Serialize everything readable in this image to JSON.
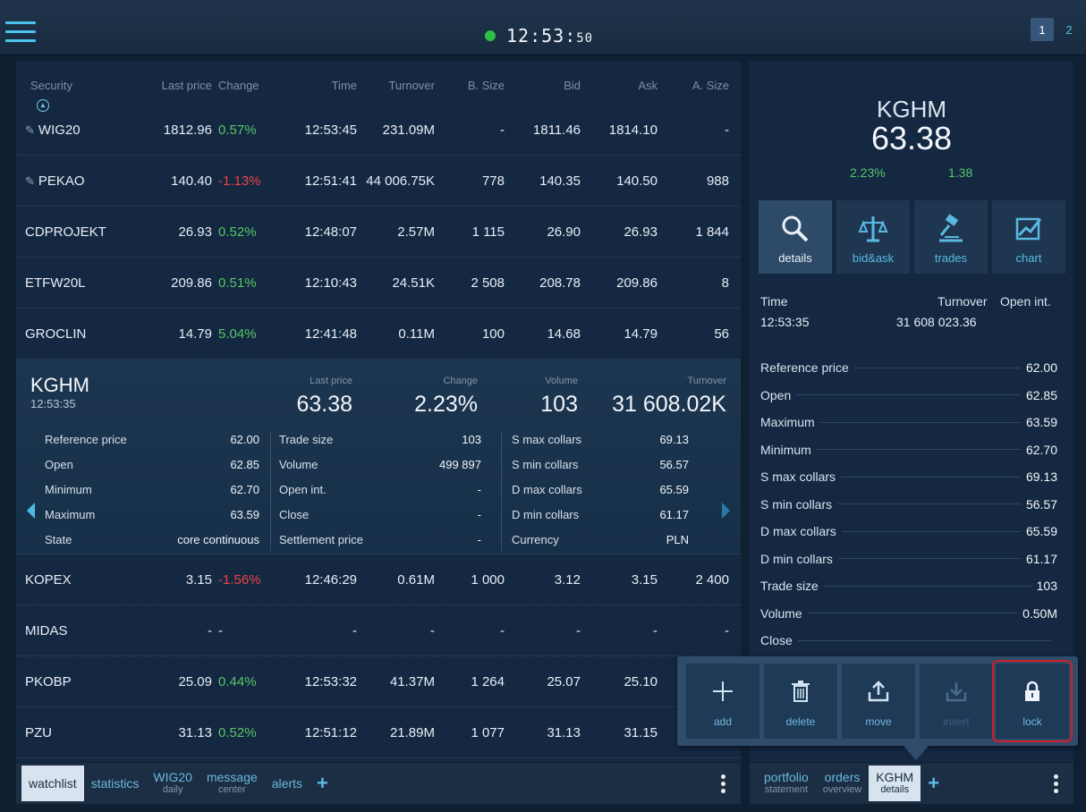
{
  "header": {
    "clock_main": "12:53:",
    "clock_sec": "50",
    "pages": [
      "1",
      "2"
    ],
    "active_page": "1",
    "status_color": "#2fbe45"
  },
  "watchlist": {
    "columns": [
      "Security",
      "Last price",
      "Change",
      "Time",
      "Turnover",
      "B. Size",
      "Bid",
      "Ask",
      "A. Size"
    ],
    "rows_top": [
      {
        "name": "WIG20",
        "pinned": true,
        "last": "1812.96",
        "change": "0.57%",
        "dir": "pos",
        "time": "12:53:45",
        "turnover": "231.09M",
        "bsize": "-",
        "bid": "1811.46",
        "ask": "1814.10",
        "asize": "-"
      },
      {
        "name": "PEKAO",
        "pinned": true,
        "last": "140.40",
        "change": "-1.13%",
        "dir": "neg",
        "time": "12:51:41",
        "turnover": "44 006.75K",
        "bsize": "778",
        "bid": "140.35",
        "ask": "140.50",
        "asize": "988"
      },
      {
        "name": "CDPROJEKT",
        "pinned": false,
        "last": "26.93",
        "change": "0.52%",
        "dir": "pos",
        "time": "12:48:07",
        "turnover": "2.57M",
        "bsize": "1 115",
        "bid": "26.90",
        "ask": "26.93",
        "asize": "1 844"
      },
      {
        "name": "ETFW20L",
        "pinned": false,
        "last": "209.86",
        "change": "0.51%",
        "dir": "pos",
        "time": "12:10:43",
        "turnover": "24.51K",
        "bsize": "2 508",
        "bid": "208.78",
        "ask": "209.86",
        "asize": "8"
      },
      {
        "name": "GROCLIN",
        "pinned": false,
        "last": "14.79",
        "change": "5.04%",
        "dir": "pos",
        "time": "12:41:48",
        "turnover": "0.11M",
        "bsize": "100",
        "bid": "14.68",
        "ask": "14.79",
        "asize": "56"
      }
    ],
    "rows_bottom": [
      {
        "name": "KOPEX",
        "last": "3.15",
        "change": "-1.56%",
        "dir": "neg",
        "time": "12:46:29",
        "turnover": "0.61M",
        "bsize": "1 000",
        "bid": "3.12",
        "ask": "3.15",
        "asize": "2 400"
      },
      {
        "name": "MIDAS",
        "last": "-",
        "change": "-",
        "dir": "none",
        "time": "-",
        "turnover": "-",
        "bsize": "-",
        "bid": "-",
        "ask": "-",
        "asize": "-"
      },
      {
        "name": "PKOBP",
        "last": "25.09",
        "change": "0.44%",
        "dir": "pos",
        "time": "12:53:32",
        "turnover": "41.37M",
        "bsize": "1 264",
        "bid": "25.07",
        "ask": "25.10",
        "asize": ""
      },
      {
        "name": "PZU",
        "last": "31.13",
        "change": "0.52%",
        "dir": "pos",
        "time": "12:51:12",
        "turnover": "21.89M",
        "bsize": "1 077",
        "bid": "31.13",
        "ask": "31.15",
        "asize": ""
      }
    ]
  },
  "expanded": {
    "name": "KGHM",
    "time": "12:53:35",
    "last_label": "Last price",
    "last": "63.38",
    "change_label": "Change",
    "change": "2.23%",
    "volume_label": "Volume",
    "volume": "103",
    "turnover_label": "Turnover",
    "turnover": "31 608.02K",
    "col1": [
      [
        "Reference price",
        "62.00"
      ],
      [
        "Open",
        "62.85"
      ],
      [
        "Minimum",
        "62.70"
      ],
      [
        "Maximum",
        "63.59"
      ],
      [
        "State",
        "core continuous"
      ]
    ],
    "col2": [
      [
        "Trade size",
        "103"
      ],
      [
        "Volume",
        "499 897"
      ],
      [
        "Open int.",
        "-"
      ],
      [
        "Close",
        "-"
      ],
      [
        "Settlement price",
        "-"
      ]
    ],
    "col3": [
      [
        "S max collars",
        "69.13"
      ],
      [
        "S min collars",
        "56.57"
      ],
      [
        "D max collars",
        "65.59"
      ],
      [
        "D min collars",
        "61.17"
      ],
      [
        "Currency",
        "PLN"
      ]
    ]
  },
  "left_tabs": [
    {
      "label": "watchlist",
      "sub": "",
      "active": true
    },
    {
      "label": "statistics",
      "sub": "",
      "active": false
    },
    {
      "label": "WIG20",
      "sub": "daily",
      "active": false
    },
    {
      "label": "message",
      "sub": "center",
      "active": false
    },
    {
      "label": "alerts",
      "sub": "",
      "active": false
    }
  ],
  "details": {
    "name": "KGHM",
    "price": "63.38",
    "change_pct": "2.23%",
    "change_abs": "1.38",
    "tabs": [
      {
        "label": "details",
        "icon": "magnifier-icon",
        "active": true
      },
      {
        "label": "bid&ask",
        "icon": "scales-icon",
        "active": false
      },
      {
        "label": "trades",
        "icon": "gavel-icon",
        "active": false
      },
      {
        "label": "chart",
        "icon": "chart-icon",
        "active": false
      }
    ],
    "time_label": "Time",
    "time_value": "12:53:35",
    "turnover_label": "Turnover",
    "turnover_value": "31 608 023.36",
    "openint_label": "Open int.",
    "list": [
      [
        "Reference price",
        "62.00"
      ],
      [
        "Open",
        "62.85"
      ],
      [
        "Maximum",
        "63.59"
      ],
      [
        "Minimum",
        "62.70"
      ],
      [
        "S max collars",
        "69.13"
      ],
      [
        "S min collars",
        "56.57"
      ],
      [
        "D max collars",
        "65.59"
      ],
      [
        "D min collars",
        "61.17"
      ],
      [
        "Trade size",
        "103"
      ],
      [
        "Volume",
        "0.50M"
      ],
      [
        "Close",
        ""
      ]
    ]
  },
  "right_tabs": [
    {
      "label": "portfolio",
      "sub": "statement",
      "active": false
    },
    {
      "label": "orders",
      "sub": "overview",
      "active": false
    },
    {
      "label": "KGHM",
      "sub": "details",
      "active": true
    }
  ],
  "popup": {
    "buttons": [
      {
        "label": "add",
        "icon": "plus-icon",
        "enabled": true
      },
      {
        "label": "delete",
        "icon": "trash-icon",
        "enabled": true
      },
      {
        "label": "move",
        "icon": "upload-icon",
        "enabled": true
      },
      {
        "label": "insert",
        "icon": "download-icon",
        "enabled": false
      },
      {
        "label": "lock",
        "icon": "lock-icon",
        "enabled": true
      }
    ]
  }
}
